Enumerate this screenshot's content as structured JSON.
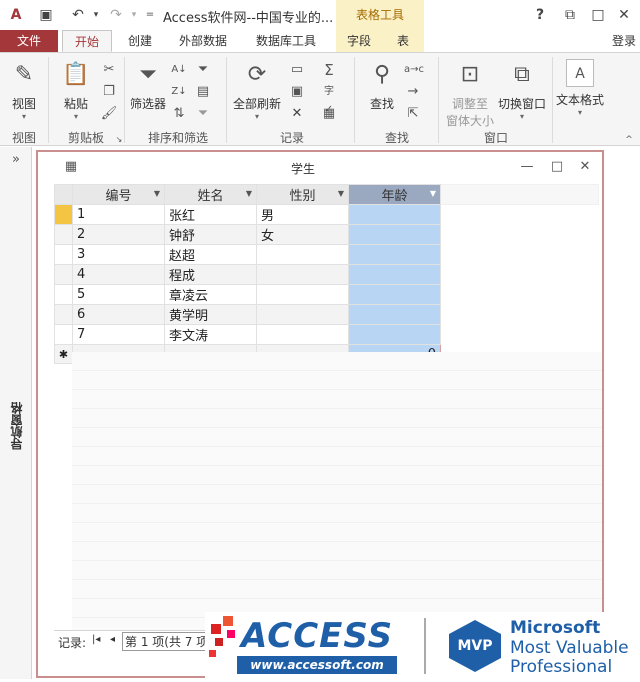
{
  "titlebar": {
    "app_title": "Access软件网--中国专业的...",
    "context_tab_title": "表格工具",
    "help": "?",
    "minimize": "—",
    "restore": "□",
    "close": "✕"
  },
  "tabs": {
    "file": "文件",
    "home": "开始",
    "create": "创建",
    "external": "外部数据",
    "dbtools": "数据库工具",
    "fields": "字段",
    "table": "表",
    "login": "登录"
  },
  "ribbon": {
    "view": {
      "button": "视图",
      "group": "视图"
    },
    "clipboard": {
      "paste": "粘贴",
      "group": "剪贴板"
    },
    "sort": {
      "filter": "筛选器",
      "group": "排序和筛选"
    },
    "records": {
      "refresh": "全部刷新",
      "group": "记录"
    },
    "find": {
      "find": "查找",
      "group": "查找"
    },
    "window": {
      "fit": "调整至\n窗体大小",
      "fit_line1": "调整至",
      "fit_line2": "窗体大小",
      "switch": "切换窗口",
      "group": "窗口"
    },
    "text": {
      "format": "文本格式"
    }
  },
  "navpane": {
    "label": "导航窗格",
    "toggle": "»"
  },
  "document": {
    "title": "学生",
    "columns": [
      "编号",
      "姓名",
      "性别",
      "年龄"
    ],
    "rows": [
      [
        "1",
        "张红",
        "男",
        ""
      ],
      [
        "2",
        "钟舒",
        "女",
        ""
      ],
      [
        "3",
        "赵超",
        "",
        ""
      ],
      [
        "4",
        "程成",
        "",
        ""
      ],
      [
        "5",
        "章凌云",
        "",
        ""
      ],
      [
        "6",
        "黄学明",
        "",
        ""
      ],
      [
        "7",
        "李文涛",
        "",
        ""
      ]
    ],
    "new_row_marker": "✱",
    "new_row_age_default": "0",
    "status_label": "记录:",
    "status_record": "第 1 项(共 7 项)"
  },
  "footer": {
    "access_logo": "ACCESS",
    "access_url": "www.accessoft.com",
    "mvp": "MVP",
    "ms_line1": "Microsoft",
    "ms_line2": "Most Valuable",
    "ms_line3": "Professional"
  },
  "colors": {
    "file_tab": "#a4373a",
    "context": "#fbf1c7",
    "selected_column": "#b8d5f4",
    "mvp_blue": "#1f5fa8"
  }
}
